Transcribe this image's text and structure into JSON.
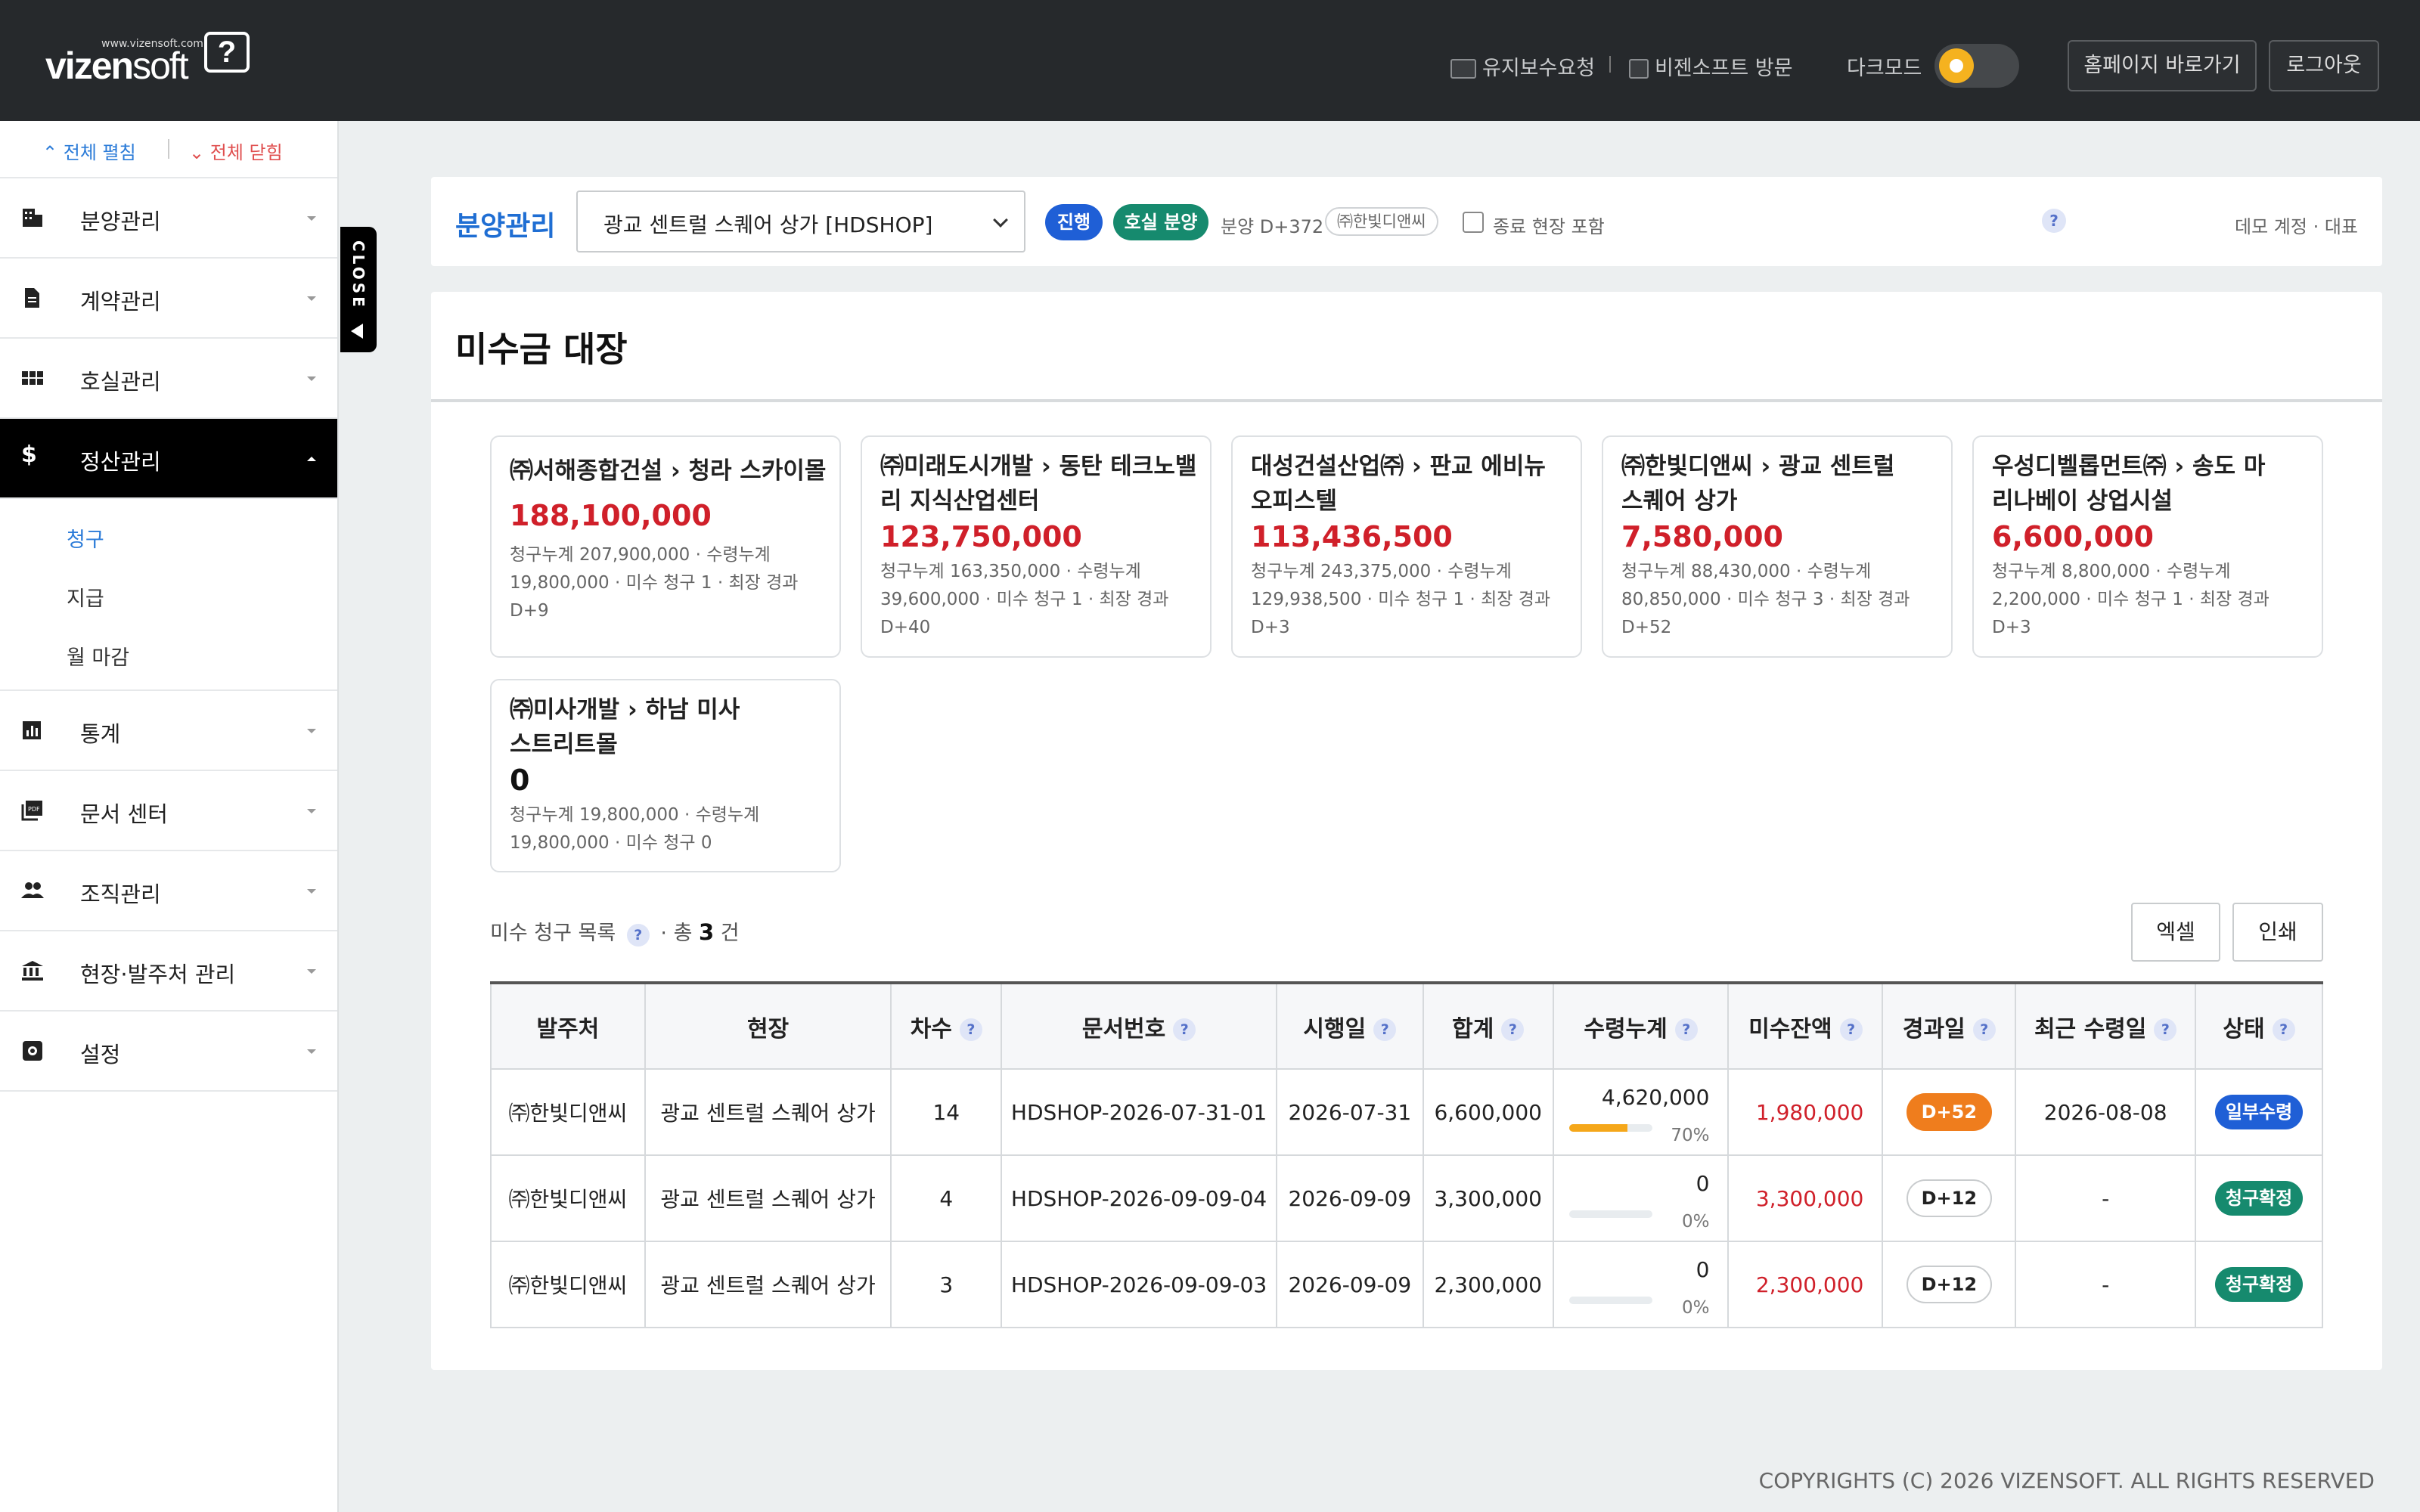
{
  "header": {
    "logo_small": "www.vizensoft.com",
    "logo_main": "vizen",
    "logo_soft": "soft",
    "logo_q": "?",
    "maint_request": "유지보수요청",
    "visit": "비젠소프트 방문",
    "darkmode_label": "다크모드",
    "homepage_btn": "홈페이지 바로가기",
    "logout_btn": "로그아웃"
  },
  "sidebar": {
    "expand_all": "⌃ 전체 펼침",
    "collapse_all": "⌄ 전체 닫힘",
    "items": [
      {
        "label": "분양관리",
        "icon": "building-icon"
      },
      {
        "label": "계약관리",
        "icon": "document-icon"
      },
      {
        "label": "호실관리",
        "icon": "grid-icon"
      },
      {
        "label": "정산관리",
        "icon": "dollar-icon"
      },
      {
        "label": "통계",
        "icon": "chart-icon"
      },
      {
        "label": "문서 센터",
        "icon": "pdf-icon"
      },
      {
        "label": "조직관리",
        "icon": "people-icon"
      },
      {
        "label": "현장·발주처 관리",
        "icon": "bank-icon"
      },
      {
        "label": "설정",
        "icon": "gear-icon"
      }
    ],
    "sub_items": [
      "청구",
      "지급",
      "월 마감"
    ],
    "close_tab": "CLOSE"
  },
  "topbar": {
    "title": "분양관리",
    "select_value": "광교 센트럴 스퀘어 상가 [HDSHOP]",
    "pill_progress": "진행",
    "pill_type": "호실 분양",
    "dday": "분양 D+372",
    "company_chip": "㈜한빛디앤씨",
    "include_closed": "종료 현장 포함",
    "help": "?",
    "account": "데모 계정 · 대표"
  },
  "main": {
    "title": "미수금 대장",
    "summaries": [
      {
        "title": "㈜서해종합건설 › 청라 스카이몰",
        "amount": "188,100,000",
        "detail": "청구누계 207,900,000 · 수령누계 19,800,000 · 미수 청구 1 · 최장 경과 D+9"
      },
      {
        "title": "㈜미래도시개발 › 동탄 테크노밸리 지식산업센터",
        "amount": "123,750,000",
        "detail": "청구누계 163,350,000 · 수령누계 39,600,000 · 미수 청구 1 · 최장 경과 D+40"
      },
      {
        "title": "대성건설산업㈜ › 판교 에비뉴 오피스텔",
        "amount": "113,436,500",
        "detail": "청구누계 243,375,000 · 수령누계 129,938,500 · 미수 청구 1 · 최장 경과 D+3"
      },
      {
        "title": "㈜한빛디앤씨 › 광교 센트럴 스퀘어 상가",
        "amount": "7,580,000",
        "detail": "청구누계 88,430,000 · 수령누계 80,850,000 · 미수 청구 3 · 최장 경과 D+52"
      },
      {
        "title": "우성디벨롭먼트㈜ › 송도 마리나베이 상업시설",
        "amount": "6,600,000",
        "detail": "청구누계 8,800,000 · 수령누계 2,200,000 · 미수 청구 1 · 최장 경과 D+3"
      },
      {
        "title": "㈜미사개발 › 하남 미사 스트리트몰",
        "amount": "0",
        "detail": "청구누계 19,800,000 · 수령누계 19,800,000 · 미수 청구 0"
      }
    ],
    "list_label": "미수 청구 목록",
    "list_total_prefix": "· 총",
    "list_total": "3",
    "list_total_suffix": "건",
    "excel_btn": "엑셀",
    "print_btn": "인쇄",
    "columns": [
      "발주처",
      "현장",
      "차수",
      "문서번호",
      "시행일",
      "합계",
      "수령누계",
      "미수잔액",
      "경과일",
      "최근 수령일",
      "상태"
    ],
    "rows": [
      {
        "client": "㈜한빛디앤씨",
        "site": "광교 센트럴 스퀘어 상가",
        "round": "14",
        "doc": "HDSHOP-2026-07-31-01",
        "date": "2026-07-31",
        "total": "6,600,000",
        "received": "4,620,000",
        "pct": "70%",
        "pct_value": 0.7,
        "balance": "1,980,000",
        "elapsed": "D+52",
        "last": "2026-08-08",
        "status": "일부수령"
      },
      {
        "client": "㈜한빛디앤씨",
        "site": "광교 센트럴 스퀘어 상가",
        "round": "4",
        "doc": "HDSHOP-2026-09-09-04",
        "date": "2026-09-09",
        "total": "3,300,000",
        "received": "0",
        "pct": "0%",
        "pct_value": 0,
        "balance": "3,300,000",
        "elapsed": "D+12",
        "last": "-",
        "status": "청구확정"
      },
      {
        "client": "㈜한빛디앤씨",
        "site": "광교 센트럴 스퀘어 상가",
        "round": "3",
        "doc": "HDSHOP-2026-09-09-03",
        "date": "2026-09-09",
        "total": "2,300,000",
        "received": "0",
        "pct": "0%",
        "pct_value": 0,
        "balance": "2,300,000",
        "elapsed": "D+12",
        "last": "-",
        "status": "청구확정"
      }
    ]
  },
  "footer": "COPYRIGHTS (C) 2026 VIZENSOFT. ALL RIGHTS RESERVED",
  "colors": {
    "accent": "#1f6ed3",
    "red": "#d0202a",
    "orange": "#ef7d1d",
    "green": "#168a6e",
    "header": "#26292c"
  }
}
